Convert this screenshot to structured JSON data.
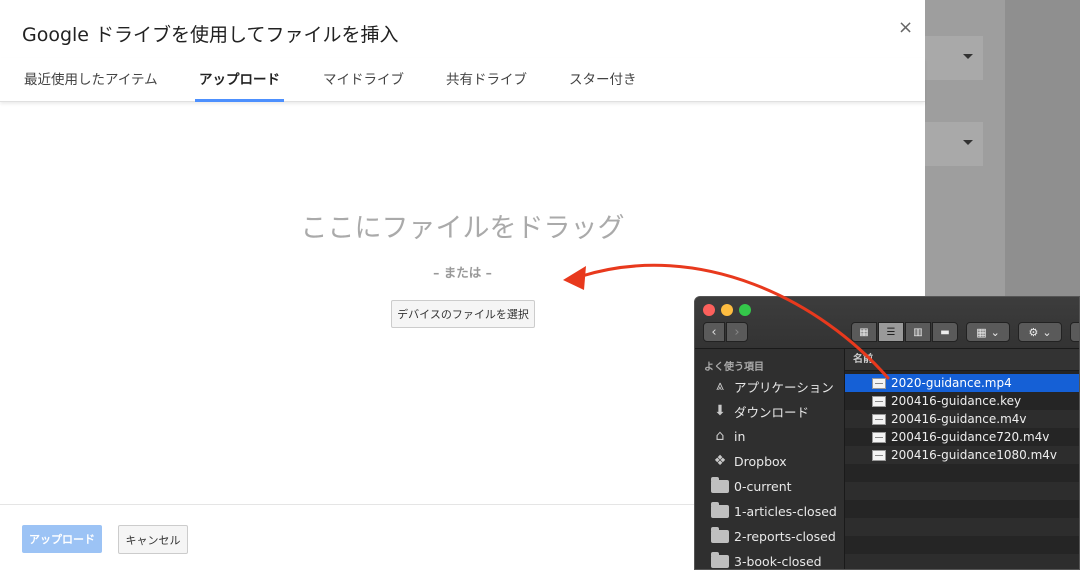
{
  "dialog": {
    "title": "Google ドライブを使用してファイルを挿入",
    "close_label": "×",
    "tabs": [
      {
        "label": "最近使用したアイテム",
        "active": false
      },
      {
        "label": "アップロード",
        "active": true
      },
      {
        "label": "マイドライブ",
        "active": false
      },
      {
        "label": "共有ドライブ",
        "active": false
      },
      {
        "label": "スター付き",
        "active": false
      }
    ],
    "drop_text": "ここにファイルをドラッグ",
    "or_text": "– または –",
    "select_button": "デバイスのファイルを選択",
    "upload_button": "アップロード",
    "cancel_button": "キャンセル",
    "accent_color": "#4d90fe"
  },
  "finder": {
    "sidebar_heading": "よく使う項目",
    "sidebar_items": [
      {
        "label": "アプリケーション",
        "icon": "applications-icon"
      },
      {
        "label": "ダウンロード",
        "icon": "downloads-icon"
      },
      {
        "label": "in",
        "icon": "home-icon"
      },
      {
        "label": "Dropbox",
        "icon": "dropbox-icon"
      },
      {
        "label": "0-current",
        "icon": "folder-icon"
      },
      {
        "label": "1-articles-closed",
        "icon": "folder-icon"
      },
      {
        "label": "2-reports-closed",
        "icon": "folder-icon"
      },
      {
        "label": "3-book-closed",
        "icon": "folder-icon"
      }
    ],
    "column_header": "名前",
    "files": [
      {
        "name": "2020-guidance.mp4",
        "selected": true
      },
      {
        "name": "200416-guidance.key",
        "selected": false
      },
      {
        "name": "200416-guidance.m4v",
        "selected": false
      },
      {
        "name": "200416-guidance720.m4v",
        "selected": false
      },
      {
        "name": "200416-guidance1080.m4v",
        "selected": false
      }
    ],
    "selection_color": "#1560d6"
  },
  "drag_arrow_color": "#e8391d"
}
